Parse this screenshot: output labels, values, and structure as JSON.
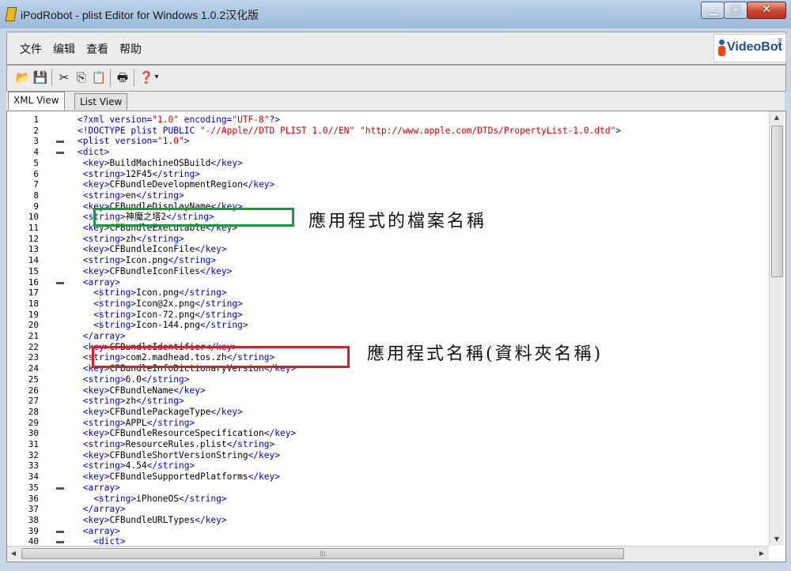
{
  "window": {
    "title": "iPodRobot - plist Editor for Windows 1.0.2汉化版",
    "buttons": {
      "minimize": "▁",
      "maximize": "□",
      "close": "✕"
    }
  },
  "menu": [
    "文件",
    "编辑",
    "查看",
    "帮助"
  ],
  "logo": {
    "text": "VideoBot",
    "sub": "Pro"
  },
  "toolbar": {
    "icons": [
      "open-folder-icon",
      "save-icon",
      "cut-icon",
      "copy-icon",
      "paste-icon",
      "print-icon",
      "help-icon"
    ],
    "glyphs": {
      "open": "📂",
      "save": "💾",
      "cut": "✂",
      "copy": "⎘",
      "paste": "📋",
      "print": "🖶",
      "help": "❓",
      "dropdown": "▾"
    }
  },
  "tabs": [
    "XML View",
    "List View"
  ],
  "active_tab": "XML View",
  "editor": {
    "lines": [
      "<?xml version=\"1.0\" encoding=\"UTF-8\"?>",
      "<!DOCTYPE plist PUBLIC \"-//Apple//DTD PLIST 1.0//EN\" \"http://www.apple.com/DTDs/PropertyList-1.0.dtd\">",
      "<plist version=\"1.0\">",
      "<dict>",
      "    <key>BuildMachineOSBuild</key>",
      "    <string>12F45</string>",
      "    <key>CFBundleDevelopmentRegion</key>",
      "    <string>en</string>",
      "    <key>CFBundleDisplayName</key>",
      "    <string>神魔之塔2</string>",
      "    <key>CFBundleExecutable</key>",
      "    <string>zh</string>",
      "    <key>CFBundleIconFile</key>",
      "    <string>Icon.png</string>",
      "    <key>CFBundleIconFiles</key>",
      "    <array>",
      "        <string>Icon.png</string>",
      "        <string>Icon@2x.png</string>",
      "        <string>Icon-72.png</string>",
      "        <string>Icon-144.png</string>",
      "    </array>",
      "    <key>CFBundleIdentifier</key>",
      "    <string>com2.madhead.tos.zh</string>",
      "    <key>CFBundleInfoDictionaryVersion</key>",
      "    <string>6.0</string>",
      "    <key>CFBundleName</key>",
      "    <string>zh</string>",
      "    <key>CFBundlePackageType</key>",
      "    <string>APPL</string>",
      "    <key>CFBundleResourceSpecification</key>",
      "    <string>ResourceRules.plist</string>",
      "    <key>CFBundleShortVersionString</key>",
      "    <string>4.54</string>",
      "    <key>CFBundleSupportedPlatforms</key>",
      "    <array>",
      "        <string>iPhoneOS</string>",
      "    </array>",
      "    <key>CFBundleURLTypes</key>",
      "    <array>",
      "        <dict>"
    ],
    "fold_lines": [
      3,
      4,
      16,
      35,
      39,
      40
    ]
  },
  "annotations": {
    "green_label": "應用程式的檔案名稱",
    "red_label": "應用程式名稱(資料夾名稱)",
    "green_color": "#1a9a3a",
    "red_color": "#d0202a"
  },
  "colors": {
    "tag": "#0000cc",
    "text": "#000000",
    "attr_value": "#cc0000"
  }
}
